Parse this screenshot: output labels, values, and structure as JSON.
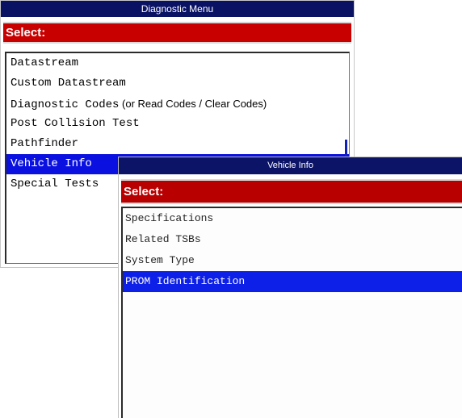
{
  "diagnostic_menu": {
    "title": "Diagnostic Menu",
    "select_label": "Select:",
    "items": [
      {
        "label": "Datastream",
        "suffix": ""
      },
      {
        "label": "Custom Datastream",
        "suffix": ""
      },
      {
        "label": "Diagnostic Codes",
        "suffix": " (or Read Codes / Clear Codes)"
      },
      {
        "label": "Post Collision Test",
        "suffix": ""
      },
      {
        "label": "Pathfinder",
        "suffix": ""
      },
      {
        "label": "Vehicle Info",
        "suffix": ""
      },
      {
        "label": "Special Tests",
        "suffix": ""
      }
    ],
    "selected_index": 5
  },
  "vehicle_info": {
    "title": "Vehicle Info",
    "select_label": "Select:",
    "items": [
      {
        "label": "Specifications"
      },
      {
        "label": "Related TSBs"
      },
      {
        "label": "System Type"
      },
      {
        "label": "PROM Identification"
      }
    ],
    "selected_index": 3
  },
  "colors": {
    "titlebar": "#0a1264",
    "select_bar": "#c90000",
    "highlight": "#0a10e0"
  }
}
